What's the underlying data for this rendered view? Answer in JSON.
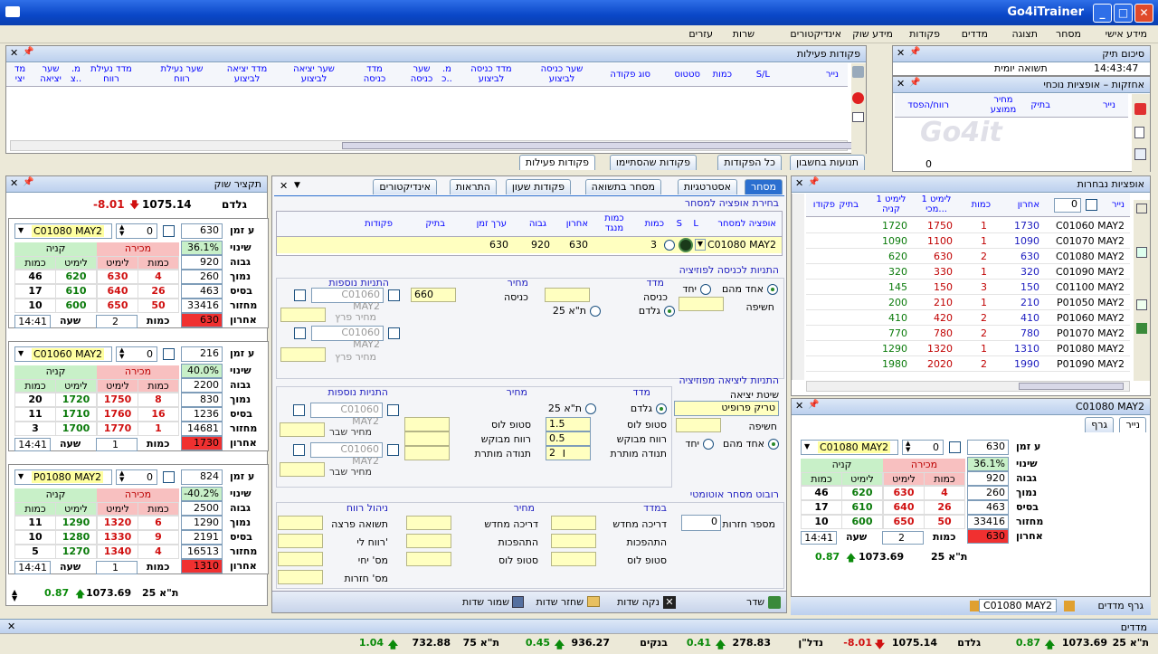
{
  "app": {
    "title": "Go4iTrainer"
  },
  "menu": [
    "מידע אישי",
    "מסחר",
    "תצוגה",
    "מדדים",
    "פקודות",
    "מידע שוק",
    "אינדיקטורים",
    "שרות",
    "עזרים"
  ],
  "active_orders": {
    "title": "פקודות פעילות",
    "cols": [
      "נייר",
      "S/L",
      "כמות",
      "סטטוס",
      "סוג פקודה",
      "שער כניסה לביצוע",
      "מדד כניסה לביצוע",
      "מ. כ..",
      "שער כניסה",
      "מדד כניסה",
      "שער יציאה לביצוע",
      "מדד יציאה לביצוע",
      "שער נעילת רווח",
      "מדד נעילת רווח",
      "מ. צ..",
      "שער יציאה",
      "מד יצי"
    ],
    "tabs": [
      "תנועות בחשבון",
      "כל הפקודות",
      "פקודות שהסתיימו",
      "פקודות פעילות"
    ]
  },
  "summary": {
    "title": "סיכום תיק",
    "label": "תשואה יומית",
    "time": "14:43:47"
  },
  "holdings": {
    "title": "אחזקות – אופציות נוכחי",
    "cols": [
      "נייר",
      "בתיק",
      "מחיר ממוצע",
      "רווח/הפסד"
    ],
    "value": "0",
    "watermark": "Go4it"
  },
  "options": {
    "title": "אופציות נבחרות",
    "cols": [
      "נייר",
      "אחרון",
      "כמות",
      "לימיט 1 מכי...",
      "לימיט 1 קניה",
      "בתיק",
      "פקודו"
    ],
    "rows": [
      [
        "C01060 MAY2",
        "1730",
        "1",
        "1750",
        "1720"
      ],
      [
        "C01070 MAY2",
        "1090",
        "1",
        "1100",
        "1090"
      ],
      [
        "C01080 MAY2",
        "630",
        "2",
        "630",
        "620"
      ],
      [
        "C01090 MAY2",
        "320",
        "1",
        "330",
        "320"
      ],
      [
        "C01100 MAY2",
        "150",
        "3",
        "150",
        "145"
      ],
      [
        "P01050 MAY2",
        "210",
        "1",
        "210",
        "200"
      ],
      [
        "P01060 MAY2",
        "410",
        "2",
        "420",
        "410"
      ],
      [
        "P01070 MAY2",
        "780",
        "2",
        "780",
        "770"
      ],
      [
        "P01080 MAY2",
        "1310",
        "1",
        "1320",
        "1290"
      ],
      [
        "P01090 MAY2",
        "1990",
        "2",
        "2020",
        "1980"
      ]
    ]
  },
  "market_summary": {
    "title": "תקציר שוק",
    "gaddam": "גלדם",
    "value": "1075.14",
    "change": "-8.01",
    "ta": "ת\"א 25",
    "ta_value": "1073.69",
    "ta_change": "0.87"
  },
  "market_labels": {
    "realtime": "ע זמן",
    "change": "שינוי",
    "high": "גבוה",
    "low": "נמוך",
    "base": "בסיס",
    "turnover": "מחזור",
    "last": "אחרון",
    "time": "שעה",
    "qty": "כמות",
    "sell": "מכירה",
    "buy": "קניה",
    "h_qty": "כמות",
    "h_limit": "לימיט"
  },
  "mw1": {
    "sym": "C01080 MAY2",
    "qty": "0",
    "rt": "630",
    "change": "36.1%",
    "high": "920",
    "low": "260",
    "base": "463",
    "turn": "33416",
    "last": "630",
    "time": "14:41",
    "lq": "2",
    "book": [
      [
        "46",
        "620",
        "630",
        "4"
      ],
      [
        "17",
        "610",
        "640",
        "26"
      ],
      [
        "10",
        "600",
        "650",
        "50"
      ]
    ]
  },
  "mw2": {
    "sym": "C01060 MAY2",
    "qty": "0",
    "rt": "216",
    "change": "40.0%",
    "high": "2200",
    "low": "830",
    "base": "1236",
    "turn": "14681",
    "last": "1730",
    "time": "14:41",
    "lq": "1",
    "book": [
      [
        "20",
        "1720",
        "1750",
        "8"
      ],
      [
        "11",
        "1710",
        "1760",
        "16"
      ],
      [
        "3",
        "1700",
        "1770",
        "1"
      ]
    ]
  },
  "mw3": {
    "sym": "P01080 MAY2",
    "qty": "0",
    "rt": "824",
    "change": "-40.2%",
    "high": "2500",
    "low": "1290",
    "base": "2191",
    "turn": "16513",
    "last": "1310",
    "time": "14:41",
    "lq": "1",
    "book": [
      [
        "11",
        "1290",
        "1320",
        "6"
      ],
      [
        "10",
        "1280",
        "1330",
        "9"
      ],
      [
        "5",
        "1270",
        "1340",
        "4"
      ]
    ]
  },
  "mw4": {
    "sym": "C01080 MAY2",
    "qty": "0",
    "rt": "630",
    "change": "36.1%",
    "high": "920",
    "low": "260",
    "base": "463",
    "turn": "33416",
    "last": "630",
    "time": "14:41",
    "lq": "2",
    "book": [
      [
        "46",
        "620",
        "630",
        "4"
      ],
      [
        "17",
        "610",
        "640",
        "26"
      ],
      [
        "10",
        "600",
        "650",
        "50"
      ]
    ],
    "ta": "ת\"א 25",
    "ta_value": "1073.69",
    "ta_change": "0.87",
    "title": "C01080 MAY2",
    "tabs": [
      "נייר",
      "גרף"
    ]
  },
  "trade": {
    "tabs": [
      "מסחר",
      "אסטרטגיות",
      "מסחר בתשואה",
      "פקודות שעון",
      "התראות",
      "אינדיקטורים"
    ],
    "select_title": "בחירת אופציה למסחר",
    "cols": [
      "אופציה למסחר",
      "L",
      "S",
      "כמות",
      "כמות מנגד",
      "אחרון",
      "גבוה",
      "ערך זמן",
      "בתיק",
      "פקודות"
    ],
    "row": {
      "sym": "C01080 MAY2",
      "qty": "3",
      "last": "630",
      "high": "920",
      "tv": "630"
    },
    "entry_title": "התניות לכניסה לפוזיציה",
    "index": "מדד",
    "price": "מחיר",
    "cond": "התניות נוספות",
    "entry": "כניסה",
    "entry_val": "660",
    "one_of": "אחד מהם",
    "single": "יחד",
    "calc": "חשיפה",
    "gadam": "גלדם",
    "ta25": "ת\"א 25",
    "sym_ghost": "C01060 MAY2",
    "break_price": "מחיר פרץ",
    "exit_title": "התניות ליציאה מפוזיציה",
    "exit_method": "שיטת יציאה",
    "exit_method_val": "טריק פרופיט",
    "stop": "סטופ לוס",
    "profit": "רווח מבוקש",
    "move": "תנודה מותרת",
    "stop_v": "1.5",
    "profit_v": "0.5",
    "move_v": "2",
    "break_label": "מחיר שבר",
    "robot_title": "רובוט מסחר אוטומטי",
    "robot_idx": "במדד",
    "robot_price": "מחיר",
    "profit_mgmt": "ניהול רווח",
    "reentry": "דריכה מחדש",
    "reverse": "התהפכות",
    "stoploss": "סטופ לוס",
    "loops": "מספר חזרות",
    "loops_v": "0",
    "pct_profit": "תשואה פרצה",
    "max_profit": "רווח לי'",
    "max_loss": "מס' יחי",
    "num_reps": "מס' חזרות",
    "buttons": [
      "שדר",
      "נקה שדות",
      "שחזר שדות",
      "שמור שדות"
    ]
  },
  "bottom": {
    "tabs": [
      "גרף מדדים",
      "C01080 MAY2"
    ],
    "status_title": "מדדים",
    "ticker": [
      [
        "ת\"א 25",
        "1073.69",
        "0.87"
      ],
      [
        "גלדם",
        "1075.14",
        "-8.01"
      ],
      [
        "נדל\"ן",
        "278.83",
        "0.41"
      ],
      [
        "בנקים",
        "936.27",
        "0.45"
      ],
      [
        "ת\"א 75",
        "732.88",
        "1.04"
      ]
    ]
  }
}
